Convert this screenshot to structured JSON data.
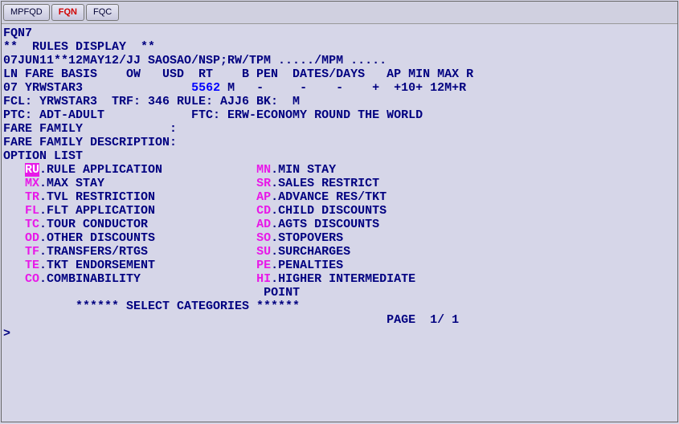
{
  "tabs": {
    "t0": "MPFQD",
    "t1": "FQN",
    "t2": "FQC"
  },
  "cmd": "FQN7",
  "title": "**  RULES DISPLAY  **",
  "routing": "07JUN11**12MAY12/JJ SAOSAO/NSP;RW/TPM ...../MPM .....",
  "header": "LN FARE BASIS    OW   USD  RT    B PEN  DATES/DAYS   AP MIN MAX R",
  "fare_ln": "07 YRWSTAR3",
  "fare_amt": "5562",
  "fare_rest": " M   -     -    -    +  +10+ 12M+R",
  "fcl": "FCL: YRWSTAR3  TRF: 346 RULE: AJJ6 BK:  M",
  "ptc": "PTC: ADT-ADULT            FTC: ERW-ECONOMY ROUND THE WORLD",
  "ff": "FARE FAMILY            :",
  "ffd": "FARE FAMILY DESCRIPTION:",
  "ol": "OPTION LIST",
  "opts": {
    "ru_c": "RU",
    "ru_d": ".RULE APPLICATION",
    "mn_c": "MN",
    "mn_d": ".MIN STAY",
    "mx_c": "MX",
    "mx_d": ".MAX STAY",
    "sr_c": "SR",
    "sr_d": ".SALES RESTRICT",
    "tr_c": "TR",
    "tr_d": ".TVL RESTRICTION",
    "ap_c": "AP",
    "ap_d": ".ADVANCE RES/TKT",
    "fl_c": "FL",
    "fl_d": ".FLT APPLICATION",
    "cd_c": "CD",
    "cd_d": ".CHILD DISCOUNTS",
    "tc_c": "TC",
    "tc_d": ".TOUR CONDUCTOR",
    "ad_c": "AD",
    "ad_d": ".AGTS DISCOUNTS",
    "od_c": "OD",
    "od_d": ".OTHER DISCOUNTS",
    "so_c": "SO",
    "so_d": ".STOPOVERS",
    "tf_c": "TF",
    "tf_d": ".TRANSFERS/RTGS",
    "su_c": "SU",
    "su_d": ".SURCHARGES",
    "te_c": "TE",
    "te_d": ".TKT ENDORSEMENT",
    "pe_c": "PE",
    "pe_d": ".PENALTIES",
    "co_c": "CO",
    "co_d": ".COMBINABILITY",
    "hi_c": "HI",
    "hi_d": ".HIGHER INTERMEDIATE",
    "hi_d2": "POINT"
  },
  "selcat": "****** SELECT CATEGORIES ******",
  "page": "PAGE  1/ 1",
  "prompt": ">"
}
